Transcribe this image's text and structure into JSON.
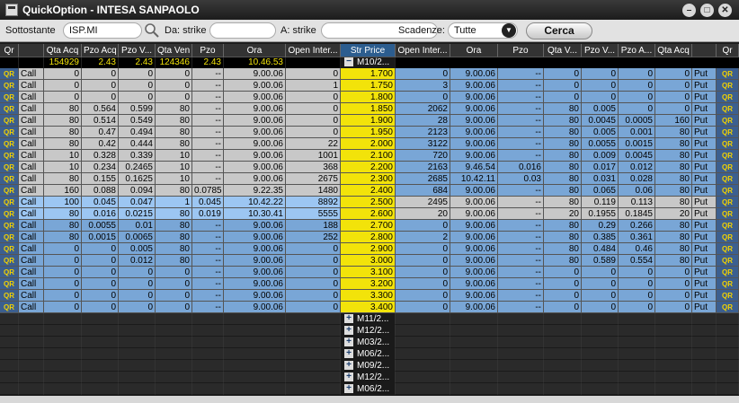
{
  "window": {
    "title": "QuickOption - INTESA SANPAOLO"
  },
  "toolbar": {
    "sottostante_label": "Sottostante",
    "sottostante_value": "ISP.MI",
    "da_label": "Da: strike",
    "da_value": "",
    "a_label": "A: strike",
    "a_value": "",
    "scadenze_label": "Scadenze:",
    "scadenze_value": "Tutte",
    "cerca_label": "Cerca"
  },
  "headers": [
    "Qr",
    "Qta Acq",
    "Pzo Acq",
    "Pzo V...",
    "Qta Ven",
    "Pzo",
    "Ora",
    "Open Inter...",
    "Str Price",
    "Open Inter...",
    "Ora",
    "Pzo",
    "Qta V...",
    "Pzo V...",
    "Pzo A...",
    "Qta Acq",
    "Qr"
  ],
  "summary": {
    "qta_acq": "154929",
    "pzo_acq": "2.43",
    "pzo_v": "2.43",
    "qta_ven": "124346",
    "pzo": "2.43",
    "ora": "10.46.53",
    "expiry": "M10/2..."
  },
  "qr_label": "QR",
  "call_label": "Call",
  "put_label": "Put",
  "rows": [
    {
      "call": [
        "0",
        "0",
        "0",
        "0",
        "--",
        "9.00.06",
        "0"
      ],
      "strike": "1.700",
      "put": [
        "0",
        "9.00.06",
        "--",
        "0",
        "0",
        "0",
        "0"
      ]
    },
    {
      "call": [
        "0",
        "0",
        "0",
        "0",
        "--",
        "9.00.06",
        "1"
      ],
      "strike": "1.750",
      "put": [
        "3",
        "9.00.06",
        "--",
        "0",
        "0",
        "0",
        "0"
      ]
    },
    {
      "call": [
        "0",
        "0",
        "0",
        "0",
        "--",
        "9.00.06",
        "0"
      ],
      "strike": "1.800",
      "put": [
        "0",
        "9.00.06",
        "--",
        "0",
        "0",
        "0",
        "0"
      ]
    },
    {
      "call": [
        "80",
        "0.564",
        "0.599",
        "80",
        "--",
        "9.00.06",
        "0"
      ],
      "strike": "1.850",
      "put": [
        "2062",
        "9.00.06",
        "--",
        "80",
        "0.005",
        "0",
        "0"
      ]
    },
    {
      "call": [
        "80",
        "0.514",
        "0.549",
        "80",
        "--",
        "9.00.06",
        "0"
      ],
      "strike": "1.900",
      "put": [
        "28",
        "9.00.06",
        "--",
        "80",
        "0.0045",
        "0.0005",
        "160"
      ]
    },
    {
      "call": [
        "80",
        "0.47",
        "0.494",
        "80",
        "--",
        "9.00.06",
        "0"
      ],
      "strike": "1.950",
      "put": [
        "2123",
        "9.00.06",
        "--",
        "80",
        "0.005",
        "0.001",
        "80"
      ]
    },
    {
      "call": [
        "80",
        "0.42",
        "0.444",
        "80",
        "--",
        "9.00.06",
        "22"
      ],
      "strike": "2.000",
      "put": [
        "3122",
        "9.00.06",
        "--",
        "80",
        "0.0055",
        "0.0015",
        "80"
      ]
    },
    {
      "call": [
        "10",
        "0.328",
        "0.339",
        "10",
        "--",
        "9.00.06",
        "1001"
      ],
      "strike": "2.100",
      "put": [
        "720",
        "9.00.06",
        "--",
        "80",
        "0.009",
        "0.0045",
        "80"
      ]
    },
    {
      "call": [
        "10",
        "0.234",
        "0.2465",
        "10",
        "--",
        "9.00.06",
        "368"
      ],
      "strike": "2.200",
      "put": [
        "2163",
        "9.46.54",
        "0.016",
        "80",
        "0.017",
        "0.012",
        "80"
      ]
    },
    {
      "call": [
        "80",
        "0.155",
        "0.1625",
        "10",
        "--",
        "9.00.06",
        "2675"
      ],
      "strike": "2.300",
      "put": [
        "2685",
        "10.42.11",
        "0.03",
        "80",
        "0.031",
        "0.028",
        "80"
      ]
    },
    {
      "call": [
        "160",
        "0.088",
        "0.094",
        "80",
        "0.0785",
        "9.22.35",
        "1480"
      ],
      "strike": "2.400",
      "put": [
        "684",
        "9.00.06",
        "--",
        "80",
        "0.065",
        "0.06",
        "80"
      ]
    },
    {
      "call": [
        "100",
        "0.045",
        "0.047",
        "1",
        "0.045",
        "10.42.22",
        "8892"
      ],
      "strike": "2.500",
      "put": [
        "2495",
        "9.00.06",
        "--",
        "80",
        "0.119",
        "0.113",
        "80"
      ]
    },
    {
      "call": [
        "80",
        "0.016",
        "0.0215",
        "80",
        "0.019",
        "10.30.41",
        "5555"
      ],
      "strike": "2.600",
      "put": [
        "20",
        "9.00.06",
        "--",
        "20",
        "0.1955",
        "0.1845",
        "20"
      ]
    },
    {
      "call": [
        "80",
        "0.0055",
        "0.01",
        "80",
        "--",
        "9.00.06",
        "188"
      ],
      "strike": "2.700",
      "put": [
        "0",
        "9.00.06",
        "--",
        "80",
        "0.29",
        "0.266",
        "80"
      ]
    },
    {
      "call": [
        "80",
        "0.0015",
        "0.0065",
        "80",
        "--",
        "9.00.06",
        "252"
      ],
      "strike": "2.800",
      "put": [
        "2",
        "9.00.06",
        "--",
        "80",
        "0.385",
        "0.361",
        "80"
      ]
    },
    {
      "call": [
        "0",
        "0",
        "0.005",
        "80",
        "--",
        "9.00.06",
        "0"
      ],
      "strike": "2.900",
      "put": [
        "0",
        "9.00.06",
        "--",
        "80",
        "0.484",
        "0.46",
        "80"
      ]
    },
    {
      "call": [
        "0",
        "0",
        "0.012",
        "80",
        "--",
        "9.00.06",
        "0"
      ],
      "strike": "3.000",
      "put": [
        "0",
        "9.00.06",
        "--",
        "80",
        "0.589",
        "0.554",
        "80"
      ]
    },
    {
      "call": [
        "0",
        "0",
        "0",
        "0",
        "--",
        "9.00.06",
        "0"
      ],
      "strike": "3.100",
      "put": [
        "0",
        "9.00.06",
        "--",
        "0",
        "0",
        "0",
        "0"
      ]
    },
    {
      "call": [
        "0",
        "0",
        "0",
        "0",
        "--",
        "9.00.06",
        "0"
      ],
      "strike": "3.200",
      "put": [
        "0",
        "9.00.06",
        "--",
        "0",
        "0",
        "0",
        "0"
      ]
    },
    {
      "call": [
        "0",
        "0",
        "0",
        "0",
        "--",
        "9.00.06",
        "0"
      ],
      "strike": "3.300",
      "put": [
        "0",
        "9.00.06",
        "--",
        "0",
        "0",
        "0",
        "0"
      ]
    },
    {
      "call": [
        "0",
        "0",
        "0",
        "0",
        "--",
        "9.00.06",
        "0"
      ],
      "strike": "3.400",
      "put": [
        "0",
        "9.00.06",
        "--",
        "0",
        "0",
        "0",
        "0"
      ]
    }
  ],
  "expiries": [
    "M11/2...",
    "M12/2...",
    "M03/2...",
    "M06/2...",
    "M09/2...",
    "M12/2...",
    "M06/2..."
  ],
  "colors": {
    "call_itm": "#c8c8c8",
    "call_otm": "#79a6d6",
    "put_itm": "#79a6d6",
    "put_otm": "#c8c8c8",
    "atm_call": "#9cc6f2",
    "atm_put": "#9cc6f2",
    "strike_yellow": "#f2e30a",
    "header": "#333333"
  }
}
